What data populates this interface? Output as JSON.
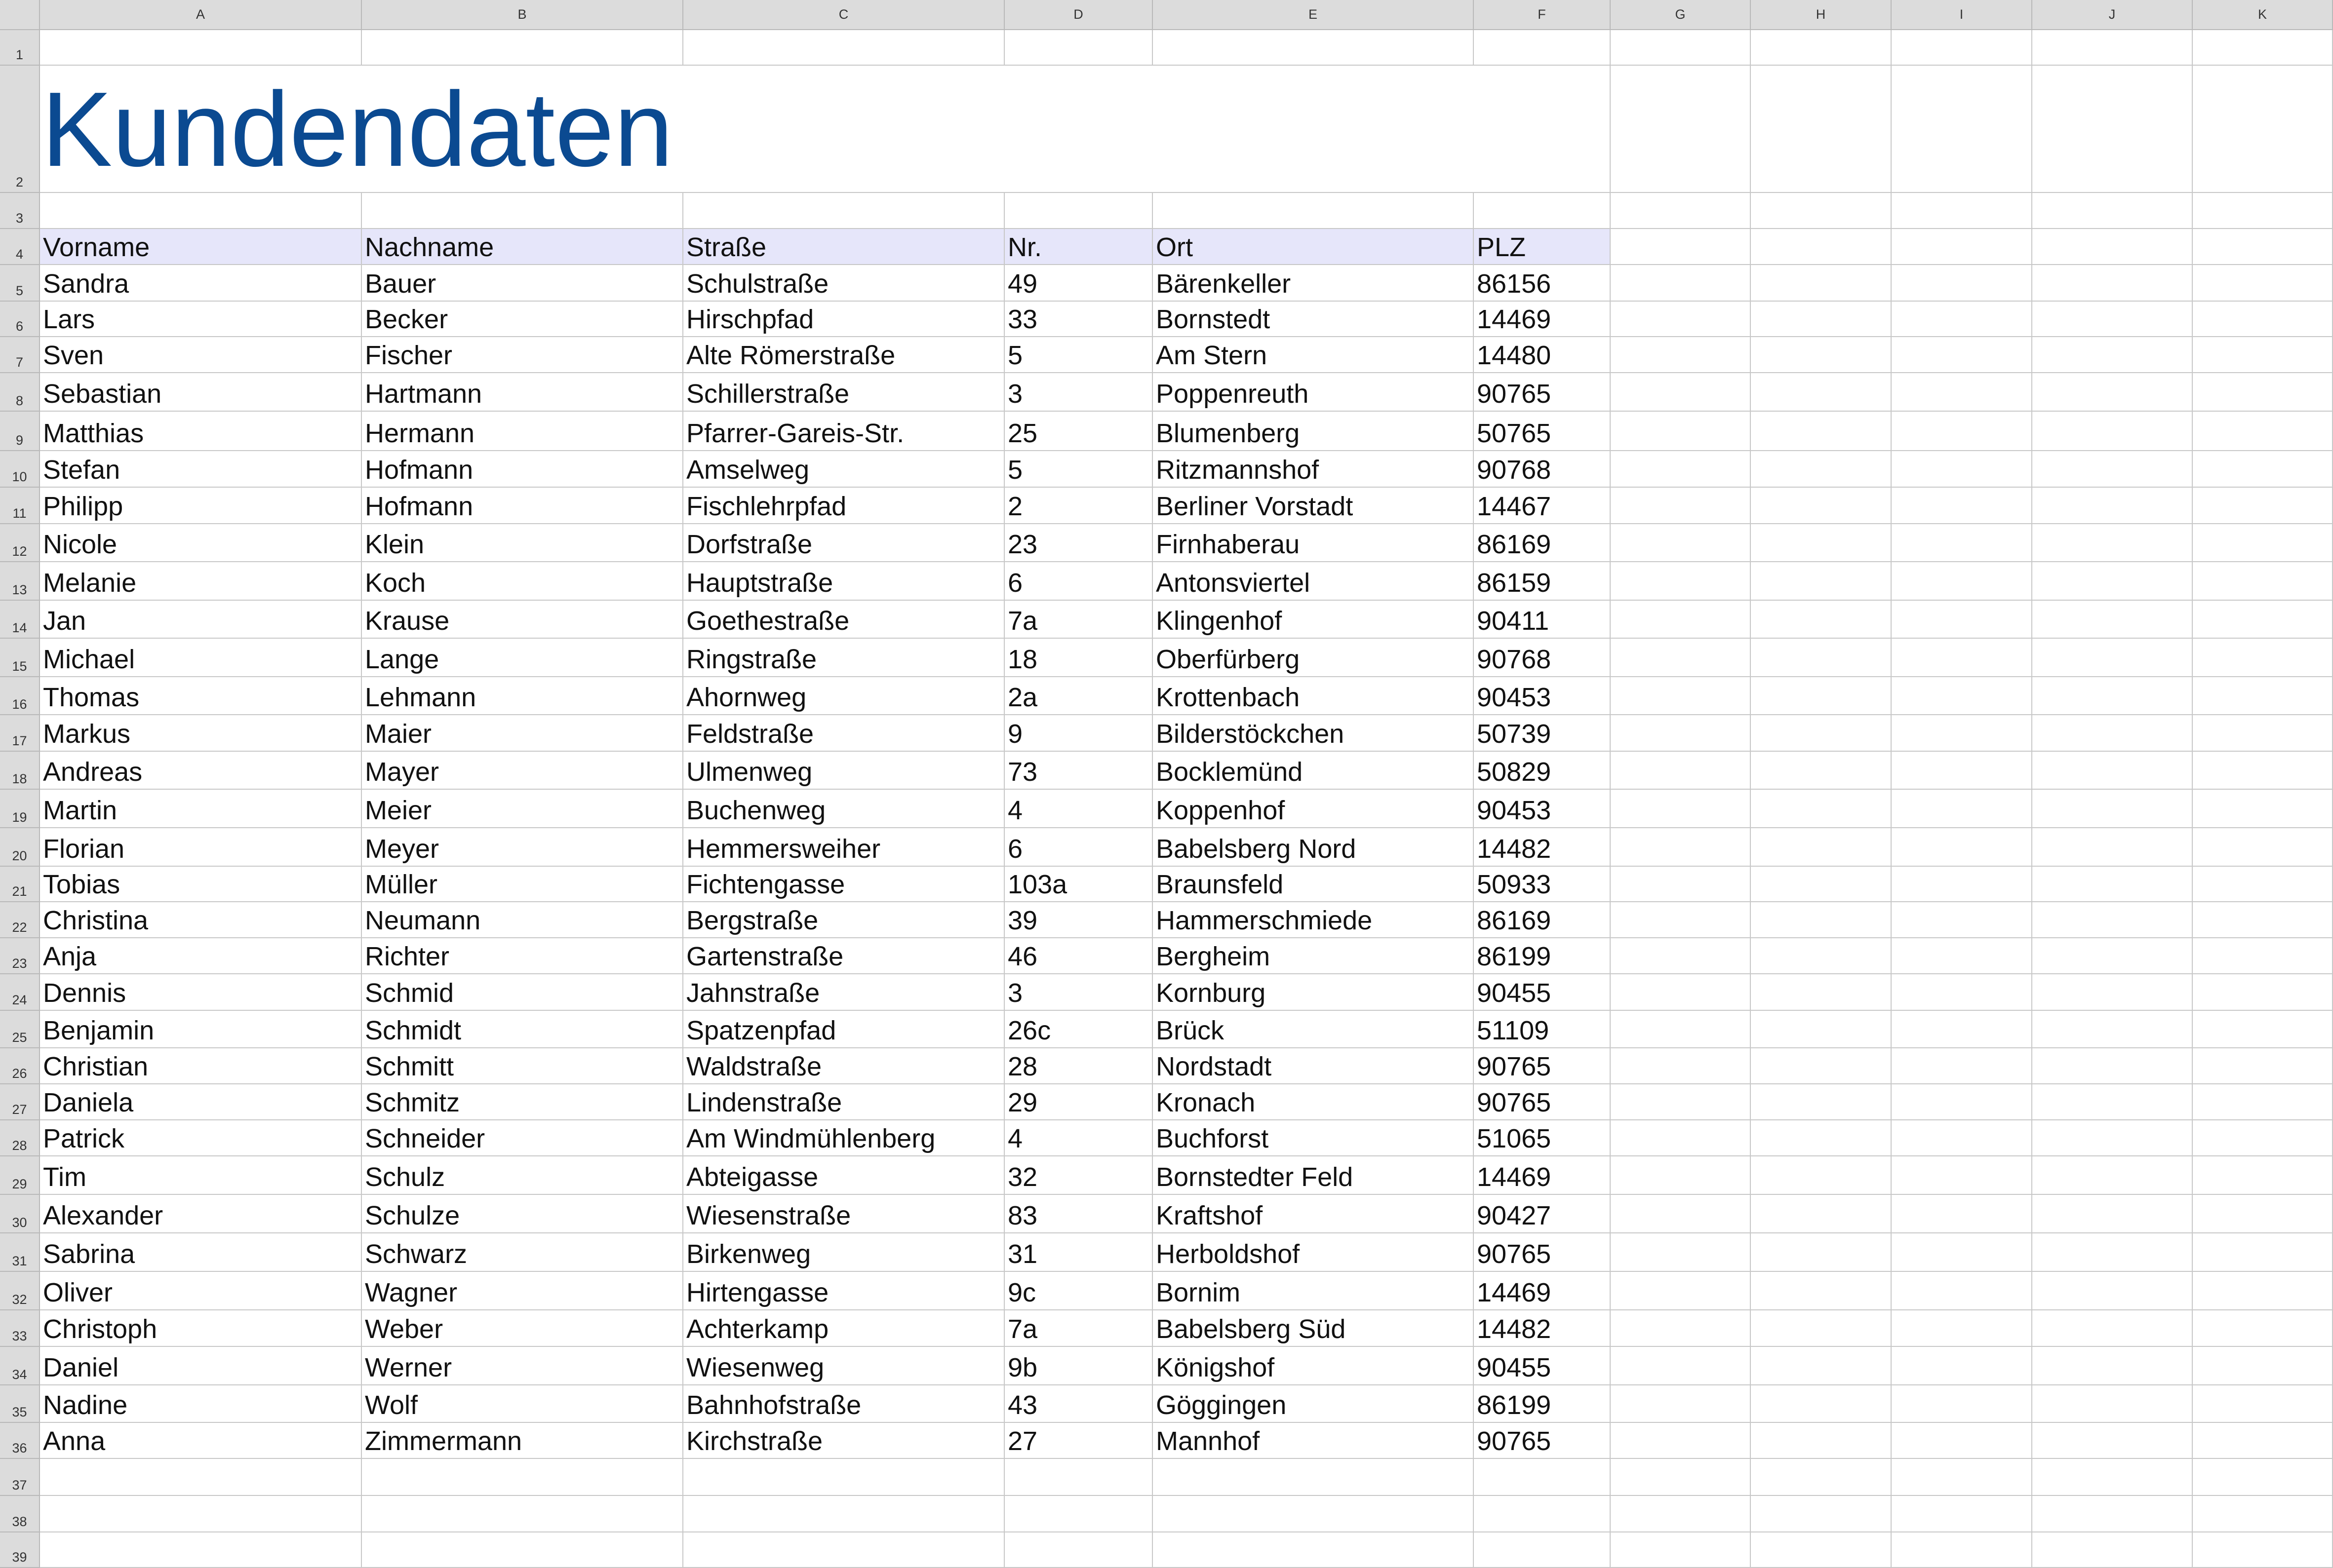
{
  "sheet": {
    "columns": [
      "A",
      "B",
      "C",
      "D",
      "E",
      "F",
      "G",
      "H",
      "I",
      "J",
      "K"
    ],
    "rows": [
      "1",
      "2",
      "3",
      "4",
      "5",
      "6",
      "7",
      "8",
      "9",
      "10",
      "11",
      "12",
      "13",
      "14",
      "15",
      "16",
      "17",
      "18",
      "19",
      "20",
      "21",
      "22",
      "23",
      "24",
      "25",
      "26",
      "27",
      "28",
      "29",
      "30",
      "31",
      "32",
      "33",
      "34",
      "35",
      "36",
      "37",
      "38",
      "39"
    ],
    "title": "Kundendaten",
    "header": [
      "Vorname",
      "Nachname",
      "Straße",
      "Nr.",
      "Ort",
      "PLZ"
    ],
    "data": [
      [
        "Sandra",
        "Bauer",
        "Schulstraße",
        "49",
        "Bärenkeller",
        "86156"
      ],
      [
        "Lars",
        "Becker",
        "Hirschpfad",
        "33",
        "Bornstedt",
        "14469"
      ],
      [
        "Sven",
        "Fischer",
        "Alte Römerstraße",
        "5",
        "Am Stern",
        "14480"
      ],
      [
        "Sebastian",
        "Hartmann",
        "Schillerstraße",
        "3",
        "Poppenreuth",
        "90765"
      ],
      [
        "Matthias",
        "Hermann",
        "Pfarrer-Gareis-Str.",
        "25",
        "Blumenberg",
        "50765"
      ],
      [
        "Stefan",
        "Hofmann",
        "Amselweg",
        "5",
        "Ritzmannshof",
        "90768"
      ],
      [
        "Philipp",
        "Hofmann",
        "Fischlehrpfad",
        "2",
        "Berliner Vorstadt",
        "14467"
      ],
      [
        "Nicole",
        "Klein",
        "Dorfstraße",
        "23",
        "Firnhaberau",
        "86169"
      ],
      [
        "Melanie",
        "Koch",
        "Hauptstraße",
        "6",
        "Antonsviertel",
        "86159"
      ],
      [
        "Jan",
        "Krause",
        "Goethestraße",
        "7a",
        "Klingenhof",
        "90411"
      ],
      [
        "Michael",
        "Lange",
        "Ringstraße",
        "18",
        "Oberfürberg",
        "90768"
      ],
      [
        "Thomas",
        "Lehmann",
        "Ahornweg",
        "2a",
        "Krottenbach",
        "90453"
      ],
      [
        "Markus",
        "Maier",
        "Feldstraße",
        "9",
        "Bilderstöckchen",
        "50739"
      ],
      [
        "Andreas",
        "Mayer",
        "Ulmenweg",
        "73",
        "Bocklemünd",
        "50829"
      ],
      [
        "Martin",
        "Meier",
        "Buchenweg",
        "4",
        "Koppenhof",
        "90453"
      ],
      [
        "Florian",
        "Meyer",
        "Hemmersweiher",
        "6",
        "Babelsberg Nord",
        "14482"
      ],
      [
        "Tobias",
        "Müller",
        "Fichtengasse",
        "103a",
        "Braunsfeld",
        "50933"
      ],
      [
        "Christina",
        "Neumann",
        "Bergstraße",
        "39",
        "Hammerschmiede",
        "86169"
      ],
      [
        "Anja",
        "Richter",
        "Gartenstraße",
        "46",
        "Bergheim",
        "86199"
      ],
      [
        "Dennis",
        "Schmid",
        "Jahnstraße",
        "3",
        "Kornburg",
        "90455"
      ],
      [
        "Benjamin",
        "Schmidt",
        "Spatzenpfad",
        "26c",
        "Brück",
        "51109"
      ],
      [
        "Christian",
        "Schmitt",
        "Waldstraße",
        "28",
        "Nordstadt",
        "90765"
      ],
      [
        "Daniela",
        "Schmitz",
        "Lindenstraße",
        "29",
        "Kronach",
        "90765"
      ],
      [
        "Patrick",
        "Schneider",
        "Am Windmühlenberg",
        "4",
        "Buchforst",
        "51065"
      ],
      [
        "Tim",
        "Schulz",
        "Abteigasse",
        "32",
        "Bornstedter Feld",
        "14469"
      ],
      [
        "Alexander",
        "Schulze",
        "Wiesenstraße",
        "83",
        "Kraftshof",
        "90427"
      ],
      [
        "Sabrina",
        "Schwarz",
        "Birkenweg",
        "31",
        "Herboldshof",
        "90765"
      ],
      [
        "Oliver",
        "Wagner",
        "Hirtengasse",
        "9c",
        "Bornim",
        "14469"
      ],
      [
        "Christoph",
        "Weber",
        "Achterkamp",
        "7a",
        "Babelsberg Süd",
        "14482"
      ],
      [
        "Daniel",
        "Werner",
        "Wiesenweg",
        "9b",
        "Königshof",
        "90455"
      ],
      [
        "Nadine",
        "Wolf",
        "Bahnhofstraße",
        "43",
        "Göggingen",
        "86199"
      ],
      [
        "Anna",
        "Zimmermann",
        "Kirchstraße",
        "27",
        "Mannhof",
        "90765"
      ]
    ],
    "colors": {
      "title": "#0b4a91",
      "header_fill": "#e6e6fa",
      "header_bar": "#dcdcdc",
      "grid": "#c8c8c8"
    }
  }
}
